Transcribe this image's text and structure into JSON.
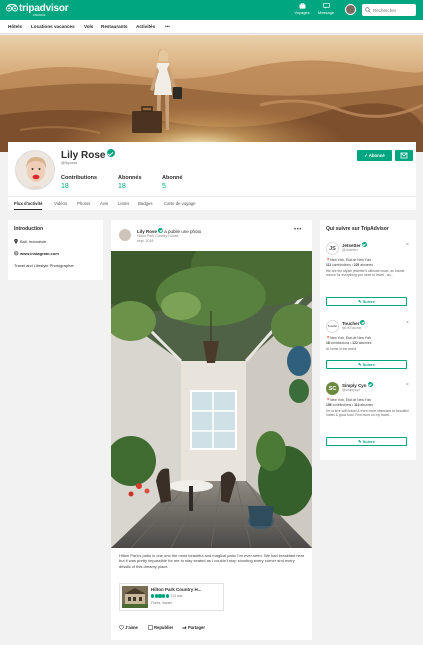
{
  "brand": {
    "name_part1": "trip",
    "name_part2": "advisor",
    "sub": "FRANCE",
    "color": "#00a680"
  },
  "topbar": {
    "icons": [
      {
        "label": "Voyages",
        "icon": "suitcase-icon"
      },
      {
        "label": "Message",
        "icon": "message-icon"
      }
    ],
    "search_placeholder": "Rechercher"
  },
  "nav": [
    "Hôtels",
    "Locations vacances",
    "Vols",
    "Restaurants",
    "Activités",
    "•••"
  ],
  "profile": {
    "name": "Lily Rose",
    "handle": "@lilyrose",
    "stats": [
      {
        "label": "Contributions",
        "value": "18"
      },
      {
        "label": "Abonnés",
        "value": "18"
      },
      {
        "label": "Abonné",
        "value": "5"
      }
    ],
    "follow_button": "✓ Abonné",
    "message_icon": "envelope-icon"
  },
  "tabs": [
    "Flux d'activité",
    "Vidéos",
    "Photos",
    "Avis",
    "Listes",
    "Badges",
    "Carte de voyage"
  ],
  "intro": {
    "title": "Introduction",
    "location": "Bali, Indonésie",
    "website": "www.instagram.com",
    "bio": "Travel and Lifestyle Photographer"
  },
  "post": {
    "author": "Lily Rose",
    "action": "a publié une photo",
    "place": "Hilton Park Country House",
    "date": "sept. 2018",
    "more": "•••",
    "caption": "Hilton Park's patio is one one the most beautiful and magical patio I've ever seen. We had breakfast here but it was pretty impossible for me to stay seated as I couldn't stop shooting every corner and every details of this dreamy place.",
    "card": {
      "name": "Hilton Park Country H...",
      "reviews": "713 avis",
      "rating": 5,
      "location": "Florès, Irlande"
    },
    "actions": [
      {
        "label": "J'aime",
        "icon": "heart-icon"
      },
      {
        "label": "Republier",
        "icon": "repost-icon"
      },
      {
        "label": "Partager",
        "icon": "share-icon"
      }
    ]
  },
  "suggestions": {
    "title": "Qui suivre sur TripAdvisor",
    "follow_label": "✎ Suivre",
    "close": "×",
    "items": [
      {
        "initials": "JS",
        "name": "Jetsetter",
        "handle": "@Jetsetter",
        "location": "New York, État de New York",
        "contributions": "111",
        "contributions_label": "contributions",
        "followers": "225",
        "followers_label": "abonnés",
        "bio": "We are the stylish jetsetter's ultimate muse, an insider source for everything you need to travel - an..."
      },
      {
        "initials": "Toucho",
        "name": "Toucher",
        "handle": "@UKToucher",
        "location": "New York, État de New York",
        "contributions": "18",
        "contributions_label": "contributions",
        "followers": "122",
        "followers_label": "abonnés",
        "bio": "At home in the world."
      },
      {
        "initials": "SC",
        "name": "Simply Cyn",
        "handle": "@simplycyn",
        "location": "New York, État de New York",
        "contributions": "155",
        "contributions_label": "contributions",
        "followers": "113",
        "followers_label": "abonnés",
        "bio": "I'm in love with travel & even more obsessed w/ beautiful hotels & good food. Find more on my travel..."
      }
    ]
  }
}
